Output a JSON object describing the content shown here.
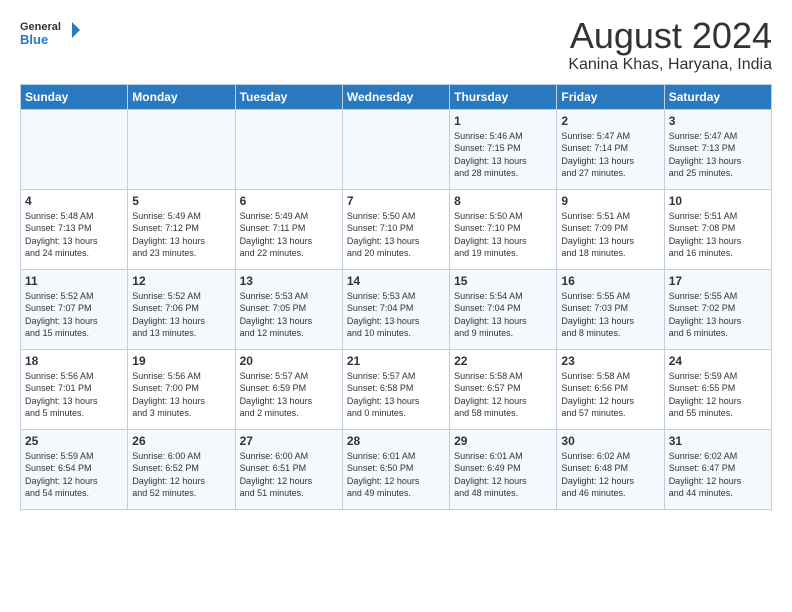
{
  "header": {
    "logo_line1": "General",
    "logo_line2": "Blue",
    "month_year": "August 2024",
    "location": "Kanina Khas, Haryana, India"
  },
  "weekdays": [
    "Sunday",
    "Monday",
    "Tuesday",
    "Wednesday",
    "Thursday",
    "Friday",
    "Saturday"
  ],
  "weeks": [
    [
      {
        "day": "",
        "info": ""
      },
      {
        "day": "",
        "info": ""
      },
      {
        "day": "",
        "info": ""
      },
      {
        "day": "",
        "info": ""
      },
      {
        "day": "1",
        "info": "Sunrise: 5:46 AM\nSunset: 7:15 PM\nDaylight: 13 hours\nand 28 minutes."
      },
      {
        "day": "2",
        "info": "Sunrise: 5:47 AM\nSunset: 7:14 PM\nDaylight: 13 hours\nand 27 minutes."
      },
      {
        "day": "3",
        "info": "Sunrise: 5:47 AM\nSunset: 7:13 PM\nDaylight: 13 hours\nand 25 minutes."
      }
    ],
    [
      {
        "day": "4",
        "info": "Sunrise: 5:48 AM\nSunset: 7:13 PM\nDaylight: 13 hours\nand 24 minutes."
      },
      {
        "day": "5",
        "info": "Sunrise: 5:49 AM\nSunset: 7:12 PM\nDaylight: 13 hours\nand 23 minutes."
      },
      {
        "day": "6",
        "info": "Sunrise: 5:49 AM\nSunset: 7:11 PM\nDaylight: 13 hours\nand 22 minutes."
      },
      {
        "day": "7",
        "info": "Sunrise: 5:50 AM\nSunset: 7:10 PM\nDaylight: 13 hours\nand 20 minutes."
      },
      {
        "day": "8",
        "info": "Sunrise: 5:50 AM\nSunset: 7:10 PM\nDaylight: 13 hours\nand 19 minutes."
      },
      {
        "day": "9",
        "info": "Sunrise: 5:51 AM\nSunset: 7:09 PM\nDaylight: 13 hours\nand 18 minutes."
      },
      {
        "day": "10",
        "info": "Sunrise: 5:51 AM\nSunset: 7:08 PM\nDaylight: 13 hours\nand 16 minutes."
      }
    ],
    [
      {
        "day": "11",
        "info": "Sunrise: 5:52 AM\nSunset: 7:07 PM\nDaylight: 13 hours\nand 15 minutes."
      },
      {
        "day": "12",
        "info": "Sunrise: 5:52 AM\nSunset: 7:06 PM\nDaylight: 13 hours\nand 13 minutes."
      },
      {
        "day": "13",
        "info": "Sunrise: 5:53 AM\nSunset: 7:05 PM\nDaylight: 13 hours\nand 12 minutes."
      },
      {
        "day": "14",
        "info": "Sunrise: 5:53 AM\nSunset: 7:04 PM\nDaylight: 13 hours\nand 10 minutes."
      },
      {
        "day": "15",
        "info": "Sunrise: 5:54 AM\nSunset: 7:04 PM\nDaylight: 13 hours\nand 9 minutes."
      },
      {
        "day": "16",
        "info": "Sunrise: 5:55 AM\nSunset: 7:03 PM\nDaylight: 13 hours\nand 8 minutes."
      },
      {
        "day": "17",
        "info": "Sunrise: 5:55 AM\nSunset: 7:02 PM\nDaylight: 13 hours\nand 6 minutes."
      }
    ],
    [
      {
        "day": "18",
        "info": "Sunrise: 5:56 AM\nSunset: 7:01 PM\nDaylight: 13 hours\nand 5 minutes."
      },
      {
        "day": "19",
        "info": "Sunrise: 5:56 AM\nSunset: 7:00 PM\nDaylight: 13 hours\nand 3 minutes."
      },
      {
        "day": "20",
        "info": "Sunrise: 5:57 AM\nSunset: 6:59 PM\nDaylight: 13 hours\nand 2 minutes."
      },
      {
        "day": "21",
        "info": "Sunrise: 5:57 AM\nSunset: 6:58 PM\nDaylight: 13 hours\nand 0 minutes."
      },
      {
        "day": "22",
        "info": "Sunrise: 5:58 AM\nSunset: 6:57 PM\nDaylight: 12 hours\nand 58 minutes."
      },
      {
        "day": "23",
        "info": "Sunrise: 5:58 AM\nSunset: 6:56 PM\nDaylight: 12 hours\nand 57 minutes."
      },
      {
        "day": "24",
        "info": "Sunrise: 5:59 AM\nSunset: 6:55 PM\nDaylight: 12 hours\nand 55 minutes."
      }
    ],
    [
      {
        "day": "25",
        "info": "Sunrise: 5:59 AM\nSunset: 6:54 PM\nDaylight: 12 hours\nand 54 minutes."
      },
      {
        "day": "26",
        "info": "Sunrise: 6:00 AM\nSunset: 6:52 PM\nDaylight: 12 hours\nand 52 minutes."
      },
      {
        "day": "27",
        "info": "Sunrise: 6:00 AM\nSunset: 6:51 PM\nDaylight: 12 hours\nand 51 minutes."
      },
      {
        "day": "28",
        "info": "Sunrise: 6:01 AM\nSunset: 6:50 PM\nDaylight: 12 hours\nand 49 minutes."
      },
      {
        "day": "29",
        "info": "Sunrise: 6:01 AM\nSunset: 6:49 PM\nDaylight: 12 hours\nand 48 minutes."
      },
      {
        "day": "30",
        "info": "Sunrise: 6:02 AM\nSunset: 6:48 PM\nDaylight: 12 hours\nand 46 minutes."
      },
      {
        "day": "31",
        "info": "Sunrise: 6:02 AM\nSunset: 6:47 PM\nDaylight: 12 hours\nand 44 minutes."
      }
    ]
  ]
}
